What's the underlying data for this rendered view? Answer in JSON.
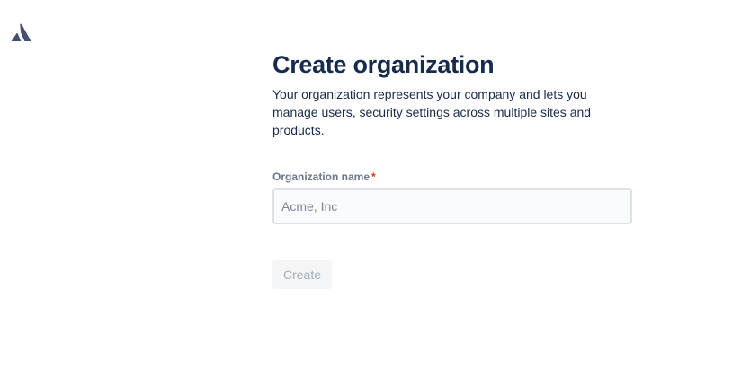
{
  "brand": {
    "logo_icon": "atlassian-logo-icon",
    "logo_color": "#42526e"
  },
  "main": {
    "title": "Create organization",
    "description": "Your organization represents your company and lets you manage users, security settings across multiple sites and products.",
    "org_name_field": {
      "label": "Organization name",
      "required_marker": "*",
      "value": "",
      "placeholder": "Acme, Inc"
    },
    "create_button": {
      "label": "Create",
      "state": "disabled"
    }
  },
  "colors": {
    "heading": "#172b4d",
    "label": "#6b778c",
    "required": "#de350b",
    "input_border": "#dfe1e6",
    "button_bg_disabled": "#f4f5f7",
    "button_text_disabled": "#a5adba"
  }
}
